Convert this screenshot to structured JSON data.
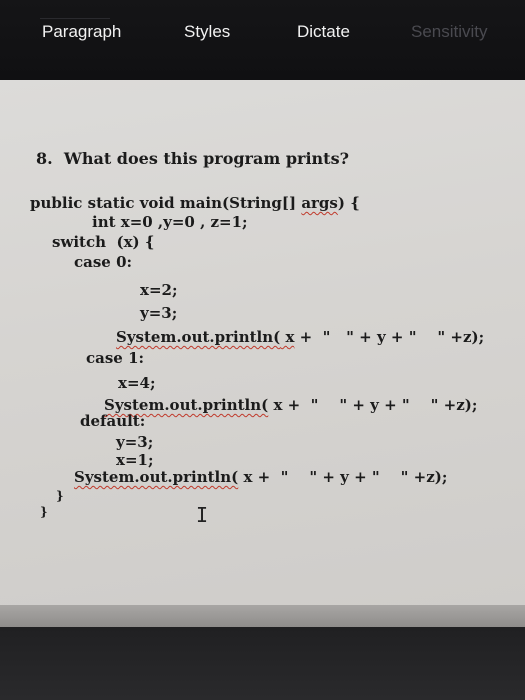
{
  "toolbar": {
    "tabs": [
      {
        "label": "Paragraph",
        "enabled": true
      },
      {
        "label": "Styles",
        "enabled": true
      },
      {
        "label": "Dictate",
        "enabled": true
      },
      {
        "label": "Sensitivity",
        "enabled": false
      }
    ]
  },
  "document": {
    "question": "8.  What does this program prints?",
    "code": {
      "signature_pre": "public static void main(String[] ",
      "signature_args": "args",
      "signature_post": ") {",
      "decl": "int x=0 ,y=0 , z=1;",
      "switch": "switch  (x) {",
      "case0": "case 0:",
      "case0_x": "x=2;",
      "case0_y": "y=3;",
      "print1_call": "System.out.println(",
      "print1_x": " x",
      "print1_rest": " +  \"   \" + y + \"    \" +z);",
      "case1": "case 1:",
      "case1_x": "x=4;",
      "print2_call": "System.out.println(",
      "print2_rest": " x +  \"    \" + y + \"    \" +z);",
      "default": "default:",
      "default_y": "y=3;",
      "default_x": "x=1;",
      "print3_call": "System.out.println(",
      "print3_rest": " x +  \"    \" + y + \"    \" +z);",
      "close1": "}",
      "close2": "}"
    },
    "text_cursor": "I"
  }
}
